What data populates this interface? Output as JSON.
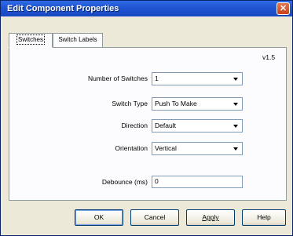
{
  "window": {
    "title": "Edit Component Properties"
  },
  "tabs": [
    {
      "label": "Switches",
      "active": true
    },
    {
      "label": "Switch Labels",
      "active": false
    }
  ],
  "version": "v1.5",
  "fields": {
    "num_switches": {
      "label": "Number of Switches",
      "value": "1"
    },
    "switch_type": {
      "label": "Switch Type",
      "value": "Push To Make"
    },
    "direction": {
      "label": "Direction",
      "value": "Default"
    },
    "orientation": {
      "label": "Orientation",
      "value": "Vertical"
    },
    "debounce": {
      "label": "Debounce (ms)",
      "value": "0"
    }
  },
  "buttons": {
    "ok": "OK",
    "cancel": "Cancel",
    "apply": "Apply",
    "help": "Help"
  },
  "icons": {
    "close": "close-icon",
    "dropdown": "chevron-down-icon"
  },
  "colors": {
    "titlebar": "#1f54d0",
    "close": "#c8401a",
    "face": "#ece9d8"
  }
}
